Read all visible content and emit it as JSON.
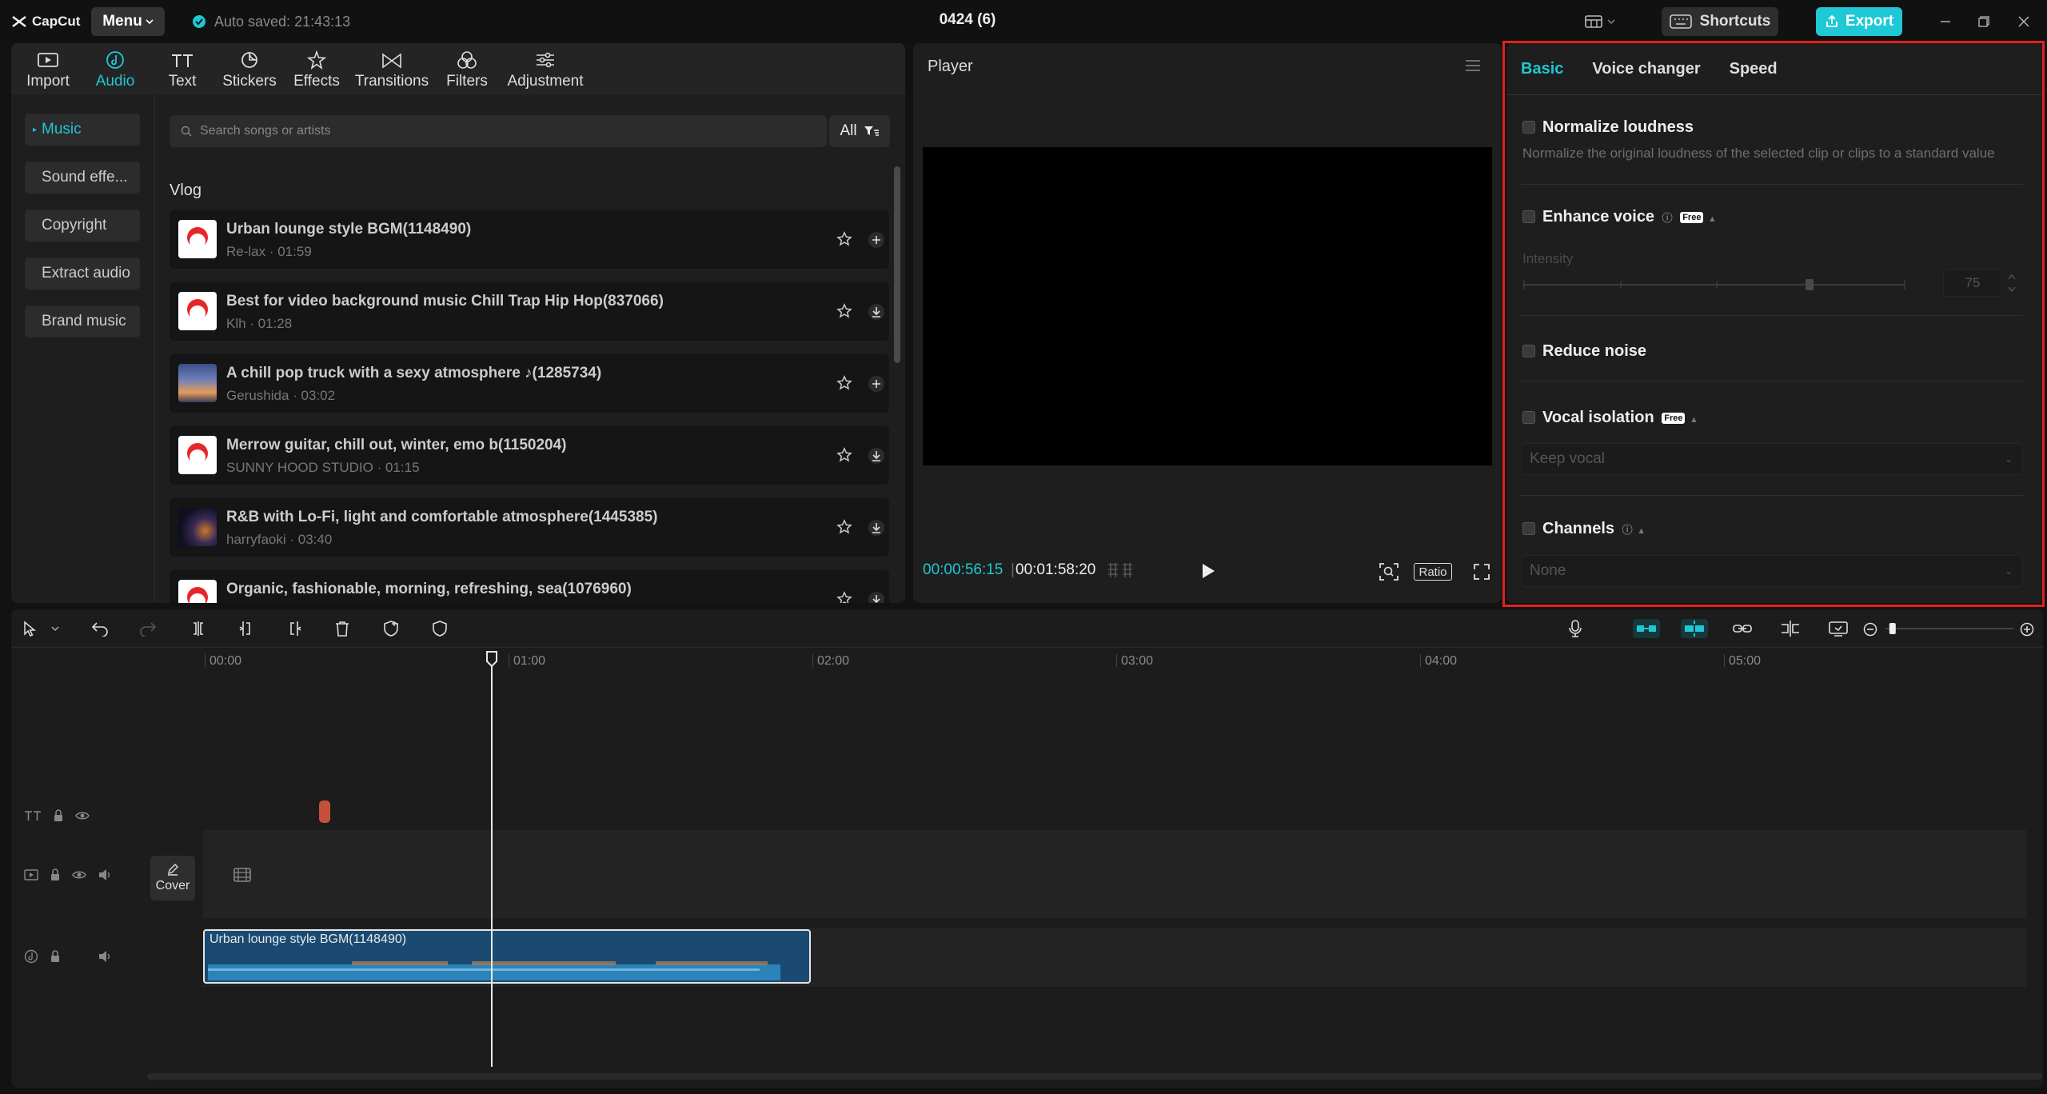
{
  "app": {
    "name": "CapCut",
    "menu_label": "Menu",
    "autosave": "Auto saved: 21:43:13",
    "project_title": "0424 (6)",
    "shortcuts_label": "Shortcuts",
    "export_label": "Export",
    "accent": "#1ec8d4"
  },
  "toolbar": {
    "items": [
      {
        "label": "Import",
        "icon": "import-icon"
      },
      {
        "label": "Audio",
        "icon": "audio-icon"
      },
      {
        "label": "Text",
        "icon": "text-icon"
      },
      {
        "label": "Stickers",
        "icon": "stickers-icon"
      },
      {
        "label": "Effects",
        "icon": "effects-icon"
      },
      {
        "label": "Transitions",
        "icon": "transitions-icon"
      },
      {
        "label": "Filters",
        "icon": "filters-icon"
      },
      {
        "label": "Adjustment",
        "icon": "adjustment-icon"
      }
    ]
  },
  "sidebar": {
    "items": [
      "Music",
      "Sound effe...",
      "Copyright",
      "Extract audio",
      "Brand music"
    ]
  },
  "library": {
    "search_placeholder": "Search songs or artists",
    "filter_label": "All",
    "section": "Vlog",
    "songs": [
      {
        "title": "Urban lounge style BGM(1148490)",
        "sub": "Re-lax · 01:59",
        "action": "add"
      },
      {
        "title": "Best for video background music Chill Trap Hip Hop(837066)",
        "sub": "Klh · 01:28",
        "action": "download"
      },
      {
        "title": "A chill pop truck with a sexy atmosphere ♪(1285734)",
        "sub": "Gerushida · 03:02",
        "action": "add"
      },
      {
        "title": "Merrow guitar, chill out, winter, emo b(1150204)",
        "sub": "SUNNY HOOD STUDIO · 01:15",
        "action": "download"
      },
      {
        "title": "R&B with Lo-Fi, light and comfortable atmosphere(1445385)",
        "sub": "harryfaoki · 03:40",
        "action": "download"
      },
      {
        "title": "Organic, fashionable, morning, refreshing, sea(1076960)",
        "sub": "",
        "action": "download"
      }
    ]
  },
  "player": {
    "title": "Player",
    "current_time": "00:00:56:15",
    "total_time": "00:01:58:20",
    "ratio_label": "Ratio"
  },
  "inspector": {
    "tabs": [
      "Basic",
      "Voice changer",
      "Speed"
    ],
    "normalize": {
      "label": "Normalize loudness",
      "desc": "Normalize the original loudness of the selected clip or clips to a standard value"
    },
    "enhance": {
      "label": "Enhance voice",
      "badge": "Free",
      "intensity_label": "Intensity",
      "intensity_value": "75",
      "intensity_fraction": 0.75
    },
    "reduce_noise": {
      "label": "Reduce noise"
    },
    "vocal_isolation": {
      "label": "Vocal isolation",
      "badge": "Free",
      "select": "Keep vocal"
    },
    "channels": {
      "label": "Channels",
      "select": "None"
    }
  },
  "timeline": {
    "ruler": [
      "00:00",
      "01:00",
      "02:00",
      "03:00",
      "04:00",
      "05:00"
    ],
    "cover_label": "Cover",
    "audio_clip": "Urban lounge style BGM(1148490)",
    "zoom_fraction": 0.03
  }
}
